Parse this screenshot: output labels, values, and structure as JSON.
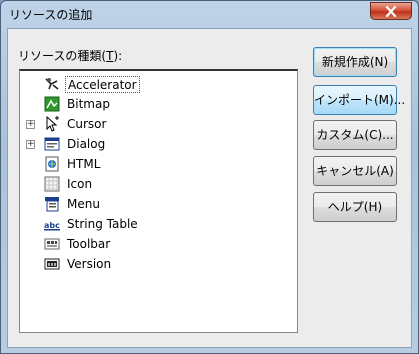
{
  "window": {
    "title": "リソースの追加"
  },
  "list_label": "リソースの種類(",
  "list_label_key": "T",
  "list_label_tail": "):",
  "tree_items": [
    {
      "label": "Accelerator",
      "icon": "accelerator-icon",
      "expandable": false,
      "selected": true
    },
    {
      "label": "Bitmap",
      "icon": "bitmap-icon",
      "expandable": false,
      "selected": false
    },
    {
      "label": "Cursor",
      "icon": "cursor-icon",
      "expandable": true,
      "selected": false
    },
    {
      "label": "Dialog",
      "icon": "dialog-icon",
      "expandable": true,
      "selected": false
    },
    {
      "label": "HTML",
      "icon": "html-icon",
      "expandable": false,
      "selected": false
    },
    {
      "label": "Icon",
      "icon": "icon-resource-icon",
      "expandable": false,
      "selected": false
    },
    {
      "label": "Menu",
      "icon": "menu-icon",
      "expandable": false,
      "selected": false
    },
    {
      "label": "String Table",
      "icon": "string-table-icon",
      "expandable": false,
      "selected": false
    },
    {
      "label": "Toolbar",
      "icon": "toolbar-icon",
      "expandable": false,
      "selected": false
    },
    {
      "label": "Version",
      "icon": "version-icon",
      "expandable": false,
      "selected": false
    }
  ],
  "buttons": {
    "new": "新規作成(N)",
    "import": "インポート(M)...",
    "custom": "カスタム(C)...",
    "cancel": "キャンセル(A)",
    "help": "ヘルプ(H)"
  },
  "expander_symbol": "+",
  "colors": {
    "title_bar": "#bfd3e8",
    "close_button": "#c0301a",
    "default_button_border": "#3c7fb1"
  }
}
